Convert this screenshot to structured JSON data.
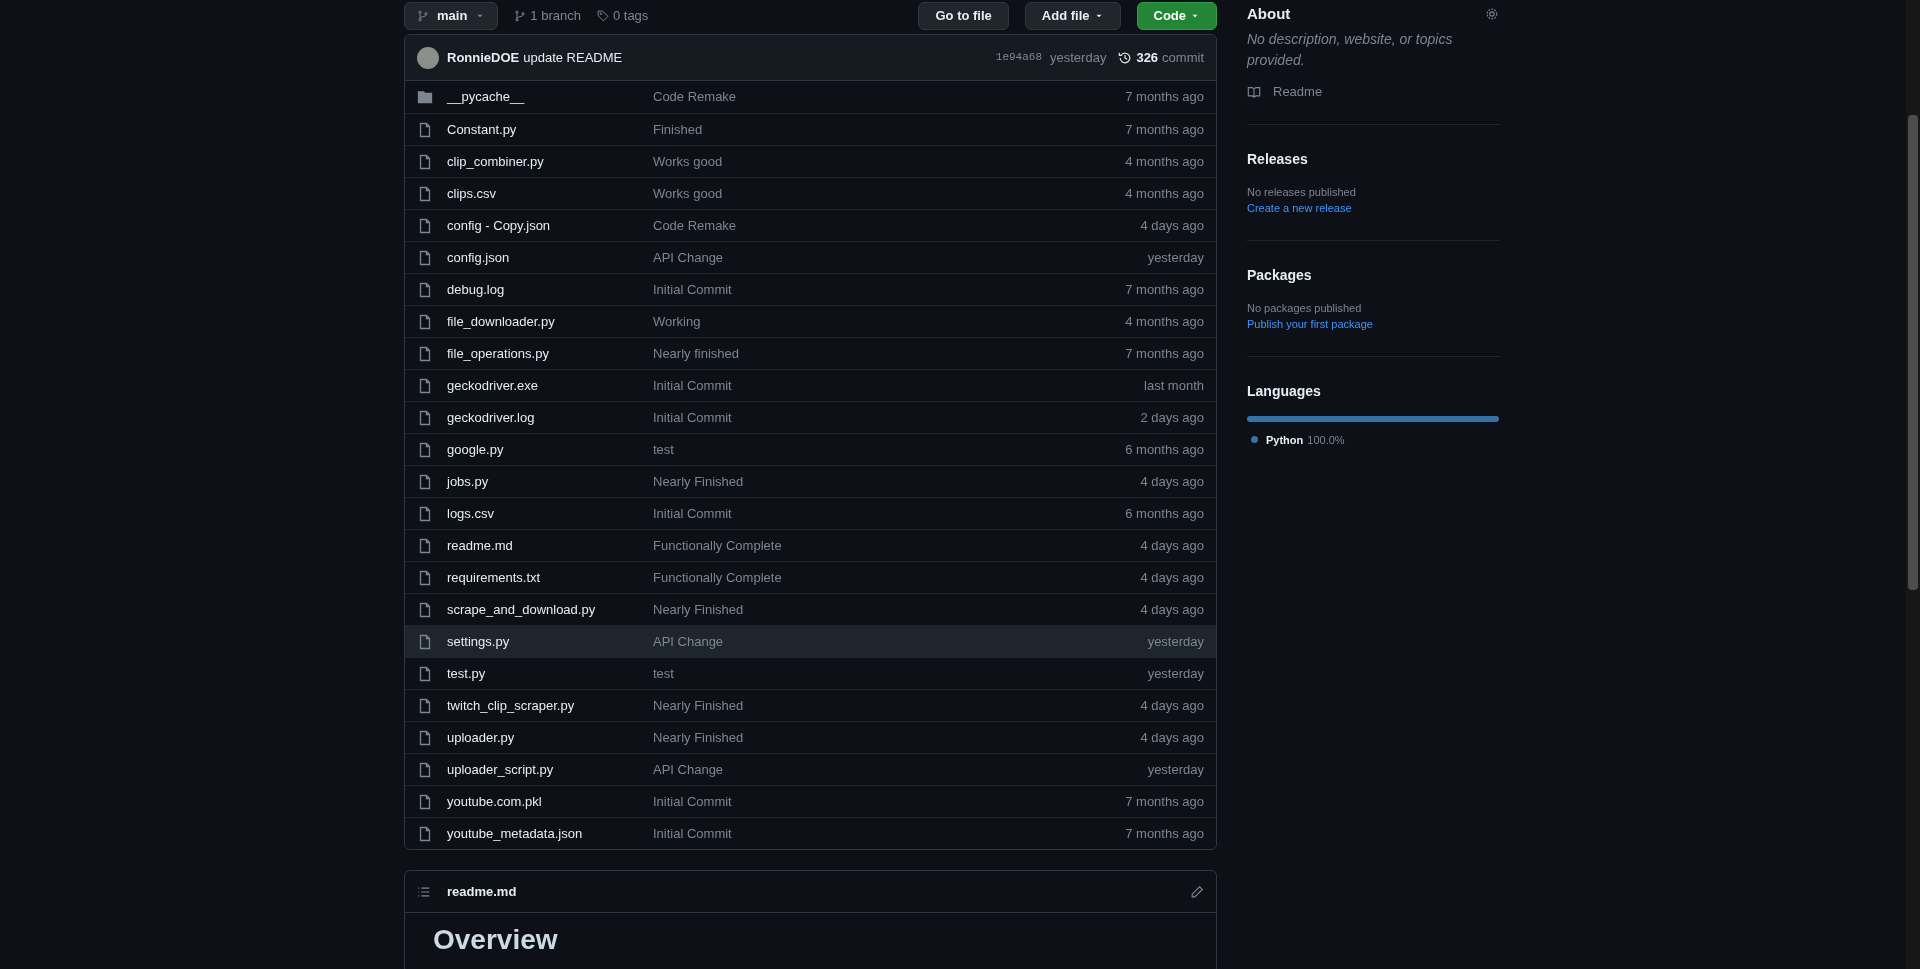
{
  "toolbar": {
    "branch": "main",
    "branches": "1 branch",
    "tags": "0 tags",
    "buttons": [
      {
        "label": "Go to file",
        "kind": "plain"
      },
      {
        "label": "Add file",
        "kind": "menu"
      },
      {
        "label": "Code",
        "kind": "primary"
      }
    ]
  },
  "commit": {
    "author": "RonnieDOE",
    "message": "update README",
    "sha": "1e94a68",
    "time": "yesterday",
    "count": "326",
    "count_label": "commit"
  },
  "files": [
    {
      "name": "__pycache__",
      "kind": "folder",
      "message": "Code Remake",
      "time": "7 months ago",
      "hovered": false
    },
    {
      "name": "Constant.py",
      "kind": "file",
      "message": "Finished",
      "time": "7 months ago",
      "hovered": false
    },
    {
      "name": "clip_combiner.py",
      "kind": "file",
      "message": "Works good",
      "time": "4 months ago",
      "hovered": false
    },
    {
      "name": "clips.csv",
      "kind": "file",
      "message": "Works good",
      "time": "4 months ago",
      "hovered": false
    },
    {
      "name": "config - Copy.json",
      "kind": "file",
      "message": "Code Remake",
      "time": "4 days ago",
      "hovered": false
    },
    {
      "name": "config.json",
      "kind": "file",
      "message": "API Change",
      "time": "yesterday",
      "hovered": false
    },
    {
      "name": "debug.log",
      "kind": "file",
      "message": "Initial Commit",
      "time": "7 months ago",
      "hovered": false
    },
    {
      "name": "file_downloader.py",
      "kind": "file",
      "message": "Working",
      "time": "4 months ago",
      "hovered": false
    },
    {
      "name": "file_operations.py",
      "kind": "file",
      "message": "Nearly finished",
      "time": "7 months ago",
      "hovered": false
    },
    {
      "name": "geckodriver.exe",
      "kind": "file",
      "message": "Initial Commit",
      "time": "last month",
      "hovered": false
    },
    {
      "name": "geckodriver.log",
      "kind": "file",
      "message": "Initial Commit",
      "time": "2 days ago",
      "hovered": false
    },
    {
      "name": "google.py",
      "kind": "file",
      "message": "test",
      "time": "6 months ago",
      "hovered": false
    },
    {
      "name": "jobs.py",
      "kind": "file",
      "message": "Nearly Finished",
      "time": "4 days ago",
      "hovered": false
    },
    {
      "name": "logs.csv",
      "kind": "file",
      "message": "Initial Commit",
      "time": "6 months ago",
      "hovered": false
    },
    {
      "name": "readme.md",
      "kind": "file",
      "message": "Functionally Complete",
      "time": "4 days ago",
      "hovered": false
    },
    {
      "name": "requirements.txt",
      "kind": "file",
      "message": "Functionally Complete",
      "time": "4 days ago",
      "hovered": false
    },
    {
      "name": "scrape_and_download.py",
      "kind": "file",
      "message": "Nearly Finished",
      "time": "4 days ago",
      "hovered": false
    },
    {
      "name": "settings.py",
      "kind": "file",
      "message": "API Change",
      "time": "yesterday",
      "hovered": true
    },
    {
      "name": "test.py",
      "kind": "file",
      "message": "test",
      "time": "yesterday",
      "hovered": false
    },
    {
      "name": "twitch_clip_scraper.py",
      "kind": "file",
      "message": "Nearly Finished",
      "time": "4 days ago",
      "hovered": false
    },
    {
      "name": "uploader.py",
      "kind": "file",
      "message": "Nearly Finished",
      "time": "4 days ago",
      "hovered": false
    },
    {
      "name": "uploader_script.py",
      "kind": "file",
      "message": "API Change",
      "time": "yesterday",
      "hovered": false
    },
    {
      "name": "youtube.com.pkl",
      "kind": "file",
      "message": "Initial Commit",
      "time": "7 months ago",
      "hovered": false
    },
    {
      "name": "youtube_metadata.json",
      "kind": "file",
      "message": "Initial Commit",
      "time": "7 months ago",
      "hovered": false
    }
  ],
  "readme": {
    "filename": "readme.md",
    "heading": "Overview"
  },
  "sidebar": {
    "about": {
      "title": "About",
      "description": "No description, website, or topics provided.",
      "readme_link": "Readme"
    },
    "releases": {
      "title": "Releases",
      "note": "No releases published",
      "link": "Create a new release"
    },
    "packages": {
      "title": "Packages",
      "note": "No packages published",
      "link": "Publish your first package"
    },
    "languages": {
      "title": "Languages",
      "items": [
        {
          "name": "Python",
          "percent": "100.0%",
          "color": "#3572a5"
        }
      ]
    }
  }
}
